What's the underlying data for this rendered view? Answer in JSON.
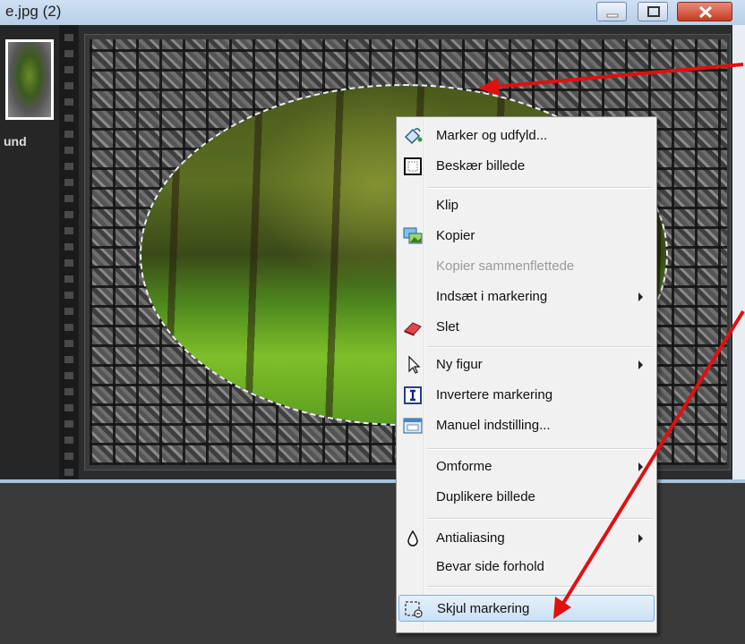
{
  "window": {
    "title": "e.jpg (2)"
  },
  "thumbnail": {
    "label": "und"
  },
  "context_menu": {
    "items": [
      {
        "label": "Marker og udfyld...",
        "icon": "paint-fill-icon",
        "disabled": false,
        "submenu": false
      },
      {
        "label": "Beskær billede",
        "icon": "crop-frame-icon",
        "disabled": false,
        "submenu": false
      },
      {
        "label": "Klip",
        "icon": "",
        "disabled": false,
        "submenu": false
      },
      {
        "label": "Kopier",
        "icon": "copy-picture-icon",
        "disabled": false,
        "submenu": false
      },
      {
        "label": "Kopier sammenflettede",
        "icon": "",
        "disabled": true,
        "submenu": false
      },
      {
        "label": "Indsæt i markering",
        "icon": "",
        "disabled": false,
        "submenu": true
      },
      {
        "label": "Slet",
        "icon": "eraser-icon",
        "disabled": false,
        "submenu": false
      },
      {
        "label": "Ny figur",
        "icon": "pointer-icon",
        "disabled": false,
        "submenu": true
      },
      {
        "label": "Invertere markering",
        "icon": "invert-selection-icon",
        "disabled": false,
        "submenu": false
      },
      {
        "label": "Manuel indstilling...",
        "icon": "manual-settings-icon",
        "disabled": false,
        "submenu": false
      },
      {
        "label": "Omforme",
        "icon": "",
        "disabled": false,
        "submenu": true
      },
      {
        "label": "Duplikere billede",
        "icon": "",
        "disabled": false,
        "submenu": false
      },
      {
        "label": "Antialiasing",
        "icon": "droplet-icon",
        "disabled": false,
        "submenu": true
      },
      {
        "label": "Bevar side forhold",
        "icon": "",
        "disabled": false,
        "submenu": false
      },
      {
        "label": "Skjul markering",
        "icon": "hide-selection-icon",
        "disabled": false,
        "submenu": false,
        "highlighted": true
      }
    ]
  },
  "colors": {
    "annotation_arrow": "#e01010",
    "menu_highlight": "#c9e0f5"
  }
}
